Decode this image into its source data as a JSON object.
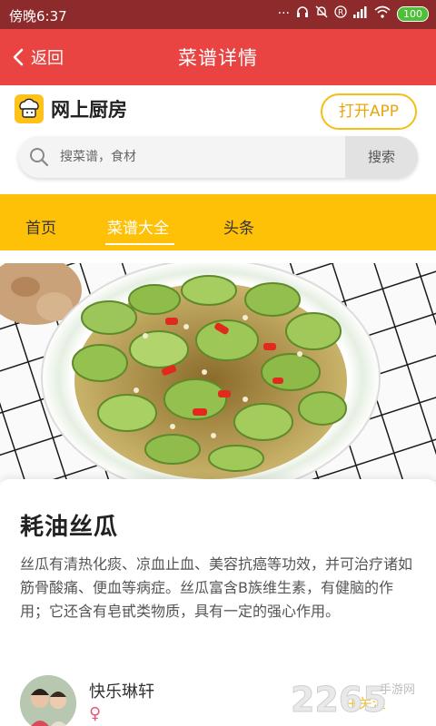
{
  "status_bar": {
    "time": "傍晚6:37",
    "battery": "100"
  },
  "header": {
    "back_label": "返回",
    "title": "菜谱详情"
  },
  "brand": {
    "name": "网上厨房",
    "open_app_label": "打开APP"
  },
  "search": {
    "placeholder": "搜菜谱，食材",
    "button_label": "搜索"
  },
  "nav": {
    "tabs": [
      {
        "label": "首页"
      },
      {
        "label": "菜谱大全"
      },
      {
        "label": "头条"
      }
    ],
    "active_index": 1
  },
  "recipe": {
    "title": "耗油丝瓜",
    "description": "丝瓜有清热化痰、凉血止血、美容抗癌等功效，并可治疗诸如筋骨酸痛、便血等病症。丝瓜富含B族维生素，有健脑的作用；它还含有皂甙类物质，具有一定的强心作用。"
  },
  "author": {
    "name": "快乐琳轩",
    "gender_symbol": "♀",
    "follow_label": "+关注"
  },
  "watermark": {
    "number": "2265",
    "text": "手游网"
  },
  "colors": {
    "status_bar": "#8d2a2b",
    "title_bar": "#e94442",
    "nav_bar": "#ffc107",
    "accent_yellow": "#f5be12"
  }
}
